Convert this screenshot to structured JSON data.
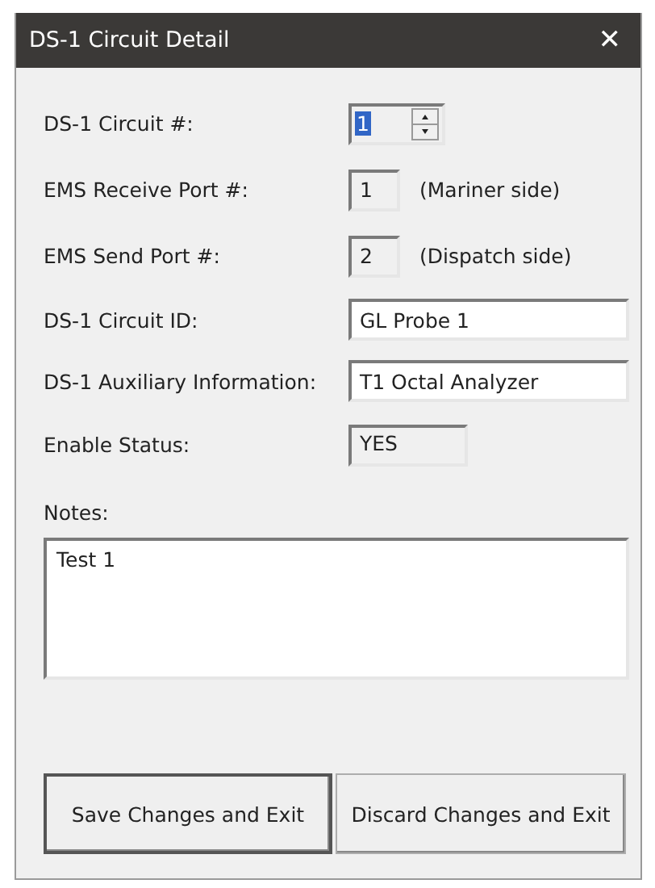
{
  "window": {
    "title": "DS-1 Circuit Detail",
    "close": "✕"
  },
  "fields": [
    {
      "kind": "spin",
      "label": "DS-1 Circuit #:",
      "value": "1",
      "selected": true
    },
    {
      "kind": "readonly",
      "label": "EMS Receive Port #:",
      "value": "1",
      "note": "(Mariner side)"
    },
    {
      "kind": "readonly",
      "label": "EMS Send Port #:",
      "value": "2",
      "note": "(Dispatch side)"
    },
    {
      "kind": "text",
      "label": "DS-1 Circuit ID:",
      "value": "GL Probe 1"
    },
    {
      "kind": "text",
      "label": "DS-1 Auxiliary Information:",
      "value": "T1 Octal Analyzer"
    },
    {
      "kind": "status",
      "label": "Enable Status:",
      "value": "YES"
    }
  ],
  "notes": {
    "label": "Notes:",
    "value": "Test 1"
  },
  "buttons": [
    {
      "label": "Save Changes and Exit",
      "default": true
    },
    {
      "label": "Discard Changes and Exit",
      "default": false
    }
  ]
}
